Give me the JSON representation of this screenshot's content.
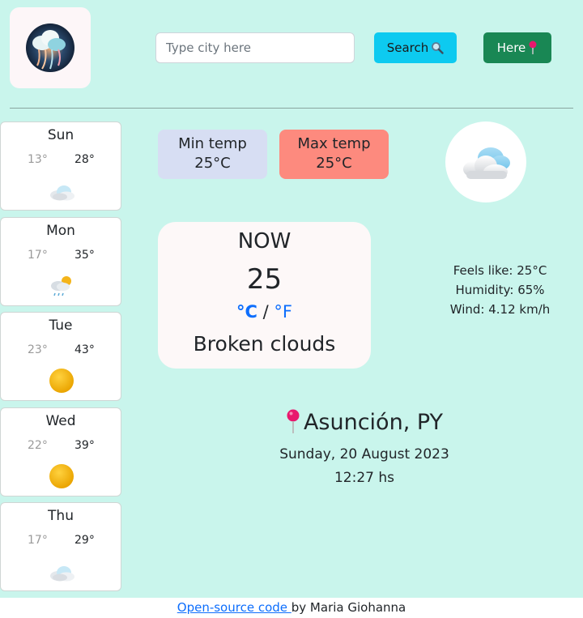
{
  "search": {
    "placeholder": "Type city here",
    "button_label": "Search",
    "here_label": "Here"
  },
  "icons": {
    "logo": "cloud-logo-icon",
    "search": "magnifier-icon",
    "here": "pushpin-icon",
    "location": "pushpin-icon"
  },
  "forecast": [
    {
      "day": "Sun",
      "min": "13°",
      "max": "28°",
      "icon": "cloud-icon"
    },
    {
      "day": "Mon",
      "min": "17°",
      "max": "35°",
      "icon": "rain-sun-icon"
    },
    {
      "day": "Tue",
      "min": "23°",
      "max": "43°",
      "icon": "sun-icon"
    },
    {
      "day": "Wed",
      "min": "22°",
      "max": "39°",
      "icon": "sun-icon"
    },
    {
      "day": "Thu",
      "min": "17°",
      "max": "29°",
      "icon": "cloud-icon"
    }
  ],
  "temps": {
    "min_label": "Min temp",
    "min_value": "25°C",
    "max_label": "Max temp",
    "max_value": "25°C"
  },
  "now": {
    "label": "NOW",
    "temp": "25",
    "unit_c": "°C",
    "separator": "/",
    "unit_f": "°F",
    "description": "Broken clouds"
  },
  "details": {
    "feels_like": "Feels like: 25°C",
    "humidity": "Humidity: 65%",
    "wind": "Wind: 4.12 km/h"
  },
  "location": {
    "city": "Asunción, PY",
    "date": "Sunday, 20 August 2023",
    "time": "12:27 hs"
  },
  "footer": {
    "link_text": "Open-source code ",
    "author_text": "by Maria Giohanna"
  },
  "colors": {
    "background": "#c9f5ec",
    "search_button": "#0dcaf0",
    "here_button": "#198754",
    "min_box": "#d7def3",
    "max_box": "#fd8a7e",
    "link": "#0d6efd"
  }
}
